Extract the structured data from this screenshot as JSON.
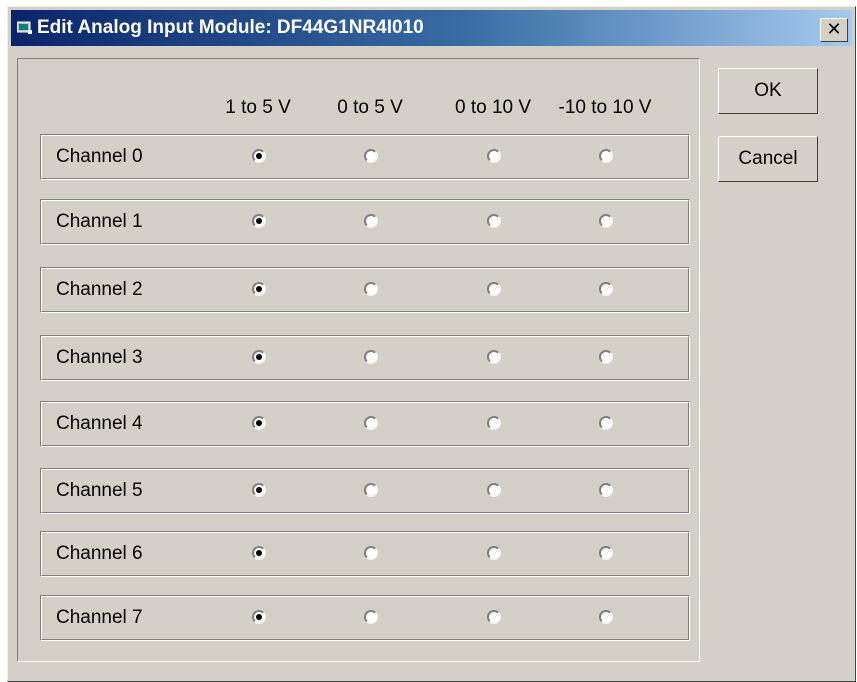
{
  "window": {
    "title": "Edit Analog Input Module: DF44G1NR4I010",
    "close_label": "✕",
    "title_icon": "module-icon"
  },
  "columns": [
    "1 to 5 V",
    "0 to 5 V",
    "0 to 10 V",
    "-10 to 10 V"
  ],
  "channels": [
    {
      "label": "Channel 0",
      "selected": "1 to 5 V"
    },
    {
      "label": "Channel 1",
      "selected": "1 to 5 V"
    },
    {
      "label": "Channel 2",
      "selected": "1 to 5 V"
    },
    {
      "label": "Channel 3",
      "selected": "1 to 5 V"
    },
    {
      "label": "Channel 4",
      "selected": "1 to 5 V"
    },
    {
      "label": "Channel 5",
      "selected": "1 to 5 V"
    },
    {
      "label": "Channel 6",
      "selected": "1 to 5 V"
    },
    {
      "label": "Channel 7",
      "selected": "1 to 5 V"
    }
  ],
  "buttons": {
    "ok_label": "OK",
    "cancel_label": "Cancel"
  },
  "colors": {
    "title_gradient_start": "#0a246a",
    "title_gradient_end": "#a6caf0",
    "face": "#d4d0c8"
  }
}
